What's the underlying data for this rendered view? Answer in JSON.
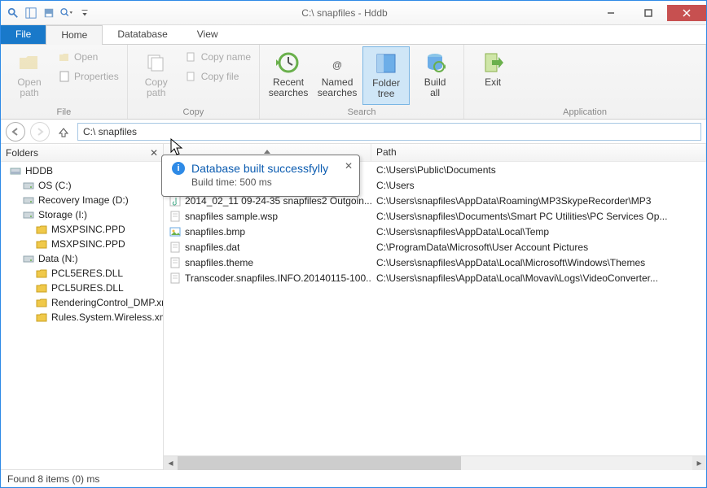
{
  "window": {
    "title": "C:\\ snapfiles - Hddb"
  },
  "qat": {
    "search": "search-icon",
    "view": "view-icon",
    "save": "save-icon",
    "dd": "dropdown-icon"
  },
  "tabs": {
    "file": "File",
    "home": "Home",
    "database": "Datatabase",
    "view": "View"
  },
  "ribbon": {
    "file_group": {
      "label": "File",
      "open_path": "Open\npath",
      "open": "Open",
      "properties": "Properties"
    },
    "copy_group": {
      "label": "Copy",
      "copy_path": "Copy\npath",
      "copy_name": "Copy name",
      "copy_file": "Copy file"
    },
    "search_group": {
      "label": "Search",
      "recent": "Recent\nsearches",
      "named": "Named\nsearches",
      "folder_tree": "Folder\ntree",
      "build_all": "Build\nall"
    },
    "app_group": {
      "label": "Application",
      "exit": "Exit"
    }
  },
  "address": {
    "path": "C:\\ snapfiles"
  },
  "folders": {
    "header": "Folders",
    "tree": [
      {
        "level": 1,
        "icon": "disk",
        "label": "HDDB"
      },
      {
        "level": 2,
        "icon": "drive",
        "label": "OS (C:)"
      },
      {
        "level": 2,
        "icon": "drive",
        "label": "Recovery Image (D:)"
      },
      {
        "level": 2,
        "icon": "drive",
        "label": "Storage (I:)"
      },
      {
        "level": 3,
        "icon": "folder",
        "label": "MSXPSINC.PPD"
      },
      {
        "level": 3,
        "icon": "folder",
        "label": "MSXPSINC.PPD"
      },
      {
        "level": 2,
        "icon": "drive",
        "label": "Data (N:)"
      },
      {
        "level": 3,
        "icon": "folder",
        "label": "PCL5ERES.DLL"
      },
      {
        "level": 3,
        "icon": "folder",
        "label": "PCL5URES.DLL"
      },
      {
        "level": 3,
        "icon": "folder",
        "label": "RenderingControl_DMP.xml"
      },
      {
        "level": 3,
        "icon": "folder",
        "label": "Rules.System.Wireless.xml"
      }
    ]
  },
  "list": {
    "col_name": "",
    "col_path": "Path",
    "rows": [
      {
        "icon": "folder",
        "name": "",
        "path": "C:\\Users\\Public\\Documents"
      },
      {
        "icon": "folder",
        "name": "",
        "path": "C:\\Users"
      },
      {
        "icon": "audio",
        "name": "2014_02_11 09-24-35 snapfiles2 Outgoin...",
        "path": "C:\\Users\\snapfiles\\AppData\\Roaming\\MP3SkypeRecorder\\MP3"
      },
      {
        "icon": "doc",
        "name": "snapfiles sample.wsp",
        "path": "C:\\Users\\snapfiles\\Documents\\Smart PC Utilities\\PC Services Op..."
      },
      {
        "icon": "image",
        "name": "snapfiles.bmp",
        "path": "C:\\Users\\snapfiles\\AppData\\Local\\Temp"
      },
      {
        "icon": "doc",
        "name": "snapfiles.dat",
        "path": "C:\\ProgramData\\Microsoft\\User Account Pictures"
      },
      {
        "icon": "doc",
        "name": "snapfiles.theme",
        "path": "C:\\Users\\snapfiles\\AppData\\Local\\Microsoft\\Windows\\Themes"
      },
      {
        "icon": "doc",
        "name": "Transcoder.snapfiles.INFO.20140115-100...",
        "path": "C:\\Users\\snapfiles\\AppData\\Local\\Movavi\\Logs\\VideoConverter..."
      }
    ]
  },
  "tooltip": {
    "title": "Database built successfylly",
    "sub": "Build time: 500 ms"
  },
  "status": {
    "text": "Found 8 items (0) ms"
  }
}
